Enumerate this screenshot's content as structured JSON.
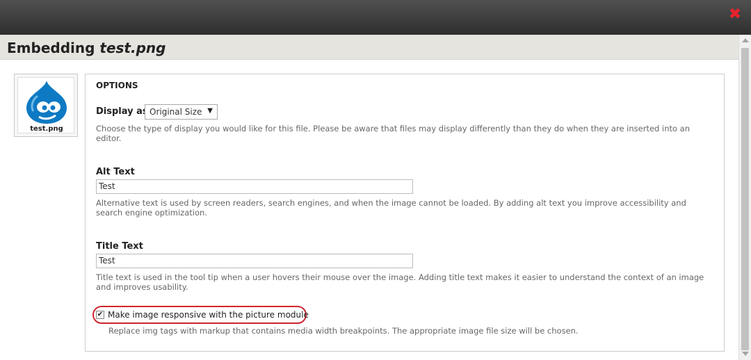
{
  "dialog": {
    "title_prefix": "Embedding",
    "title_file": "test.png",
    "close_symbol": "✖"
  },
  "preview": {
    "filename": "test.png",
    "icon": "drupal-drop-icon"
  },
  "options": {
    "legend": "OPTIONS",
    "display_as": {
      "label": "Display as",
      "value": "Original Size",
      "description": "Choose the type of display you would like for this file. Please be aware that files may display differently than they do when they are inserted into an editor."
    },
    "alt_text": {
      "label": "Alt Text",
      "value": "Test",
      "description": "Alternative text is used by screen readers, search engines, and when the image cannot be loaded. By adding alt text you improve accessibility and search engine optimization."
    },
    "title_text": {
      "label": "Title Text",
      "value": "Test",
      "description": "Title text is used in the tool tip when a user hovers their mouse over the image. Adding title text makes it easier to understand the context of an image and improves usability."
    },
    "responsive": {
      "label": "Make image responsive with the picture module",
      "checked": true,
      "description": "Replace img tags with markup that contains media width breakpoints. The appropriate image file size will be chosen."
    }
  },
  "colors": {
    "close": "#e8232d",
    "highlight": "#d0252f",
    "drupal_blue": "#0d7ac3"
  }
}
